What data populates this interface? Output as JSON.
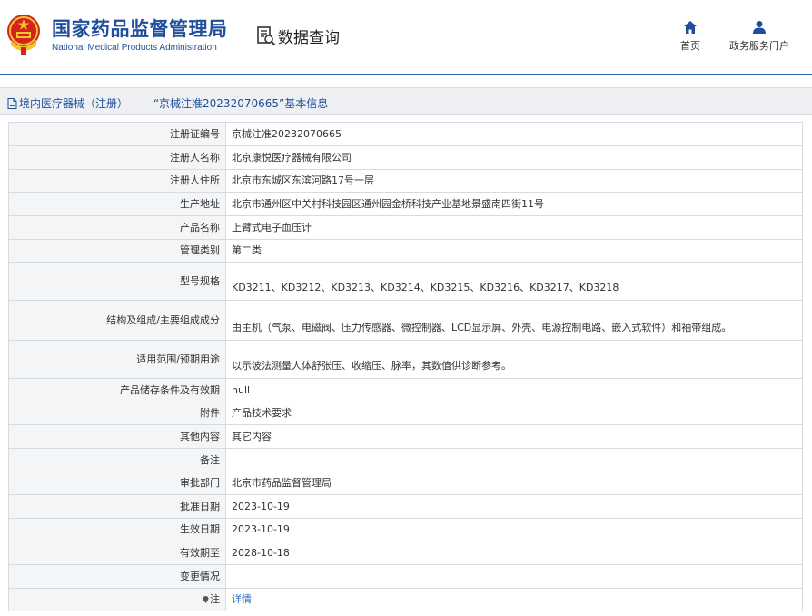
{
  "header": {
    "org_name_cn": "国家药品监督管理局",
    "org_name_en": "National Medical Products Administration",
    "query_title": "数据查询",
    "nav": [
      {
        "label": "首页",
        "icon": "home-icon"
      },
      {
        "label": "政务服务门户",
        "icon": "user-icon"
      }
    ]
  },
  "breadcrumb": {
    "text": "境内医疗器械（注册） ——“京械注准20232070665”基本信息"
  },
  "colors": {
    "brand_blue": "#1e4e9c",
    "link_blue": "#2b6cb8",
    "label_bg": "#f4f5f7",
    "border": "#d6dbe2",
    "emblem_red": "#d4231a",
    "emblem_gold": "#f2c230"
  },
  "details": [
    {
      "label": "注册证编号",
      "value": "京械注准20232070665"
    },
    {
      "label": "注册人名称",
      "value": "北京康悦医疗器械有限公司"
    },
    {
      "label": "注册人住所",
      "value": "北京市东城区东滨河路17号一层"
    },
    {
      "label": "生产地址",
      "value": "北京市通州区中关村科技园区通州园金桥科技产业基地景盛南四街11号"
    },
    {
      "label": "产品名称",
      "value": "上臂式电子血压计"
    },
    {
      "label": "管理类别",
      "value": "第二类"
    },
    {
      "label": "型号规格",
      "value": "KD3211、KD3212、KD3213、KD3214、KD3215、KD3216、KD3217、KD3218"
    },
    {
      "label": "结构及组成/主要组成成分",
      "value": "由主机（气泵、电磁阀、压力传感器、微控制器、LCD显示屏、外壳、电源控制电路、嵌入式软件）和袖带组成。"
    },
    {
      "label": "适用范围/预期用途",
      "value": "以示波法测量人体舒张压、收缩压、脉率，其数值供诊断参考。"
    },
    {
      "label": "产品储存条件及有效期",
      "value": "null"
    },
    {
      "label": "附件",
      "value": "产品技术要求"
    },
    {
      "label": "其他内容",
      "value": "其它内容"
    },
    {
      "label": "备注",
      "value": ""
    },
    {
      "label": "审批部门",
      "value": "北京市药品监督管理局"
    },
    {
      "label": "批准日期",
      "value": "2023-10-19"
    },
    {
      "label": "生效日期",
      "value": "2023-10-19"
    },
    {
      "label": "有效期至",
      "value": "2028-10-18"
    },
    {
      "label": "变更情况",
      "value": ""
    },
    {
      "label": "注",
      "value": "详情",
      "icon": "pin-icon"
    }
  ]
}
